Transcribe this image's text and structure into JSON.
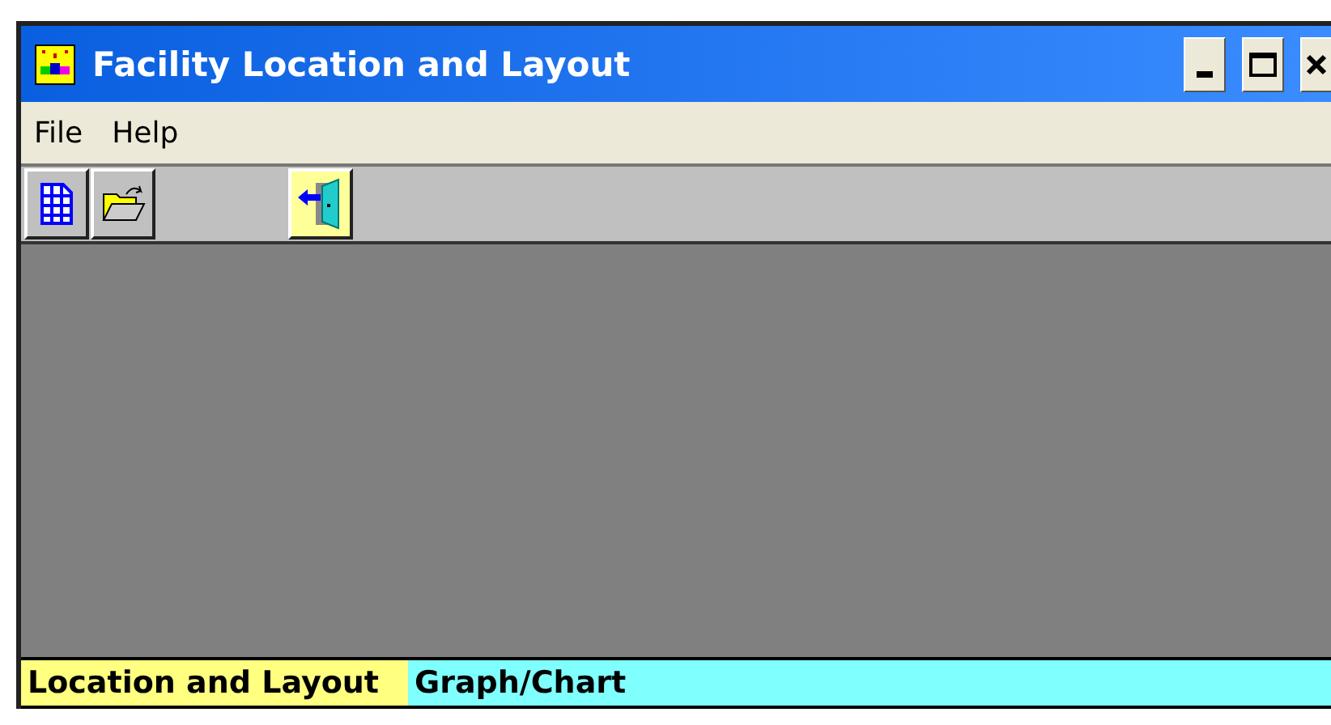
{
  "window": {
    "title": "Facility Location and Layout"
  },
  "menu": [
    "File",
    "Help"
  ],
  "toolbar": [
    {
      "kind": "grid"
    },
    {
      "kind": "open"
    },
    {
      "kind": "spacer"
    },
    {
      "kind": "exit"
    }
  ],
  "tabs": [
    {
      "label": "Location and Layout",
      "color": "#ffff80"
    },
    {
      "label": "Graph/Chart",
      "color": "#80ffff"
    }
  ]
}
